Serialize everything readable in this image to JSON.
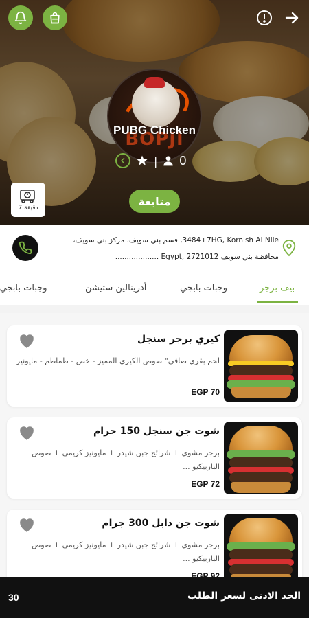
{
  "header": {
    "icons": {
      "notification": "bell-icon",
      "cart": "shopping-bag-icon",
      "info": "info-icon",
      "back": "arrow-right-icon"
    },
    "accent_color": "#7cb342"
  },
  "store": {
    "name": "PUBG Chicken",
    "logo_text": "BOPJI",
    "follower_count": "0",
    "follow_label": "متابعة",
    "delivery_time": "7 دقيقة"
  },
  "address": {
    "line1": "3484+7HG, Kornish Al Nile, قسم بني سويف، مركز بنى سويف،",
    "line2": "محافظة بني سويف 2721012 ,Egypt ..................."
  },
  "tabs": [
    {
      "label": "بيف برجر",
      "active": true
    },
    {
      "label": "وجبات بابجي",
      "active": false
    },
    {
      "label": "أدرينالين ستيشن",
      "active": false
    },
    {
      "label": "وجبات بابجي ل",
      "active": false
    }
  ],
  "products": [
    {
      "title": "كيري برجر سنجل",
      "description": "لحم بقري صافي\" صوص الكيري المميز - خص - طماطم - مايونيز",
      "price": "EGP 70"
    },
    {
      "title": "شوت جن سنجل 150 جرام",
      "description": "برجر مشوي + شرائح جبن شيدر + مايونيز كريمي + صوص الباربيكيو ...",
      "price": "EGP 72"
    },
    {
      "title": "شوت جن دابل 300 جرام",
      "description": "برجر مشوي + شرائح جبن شيدر + مايونيز كريمي + صوص الباربيكيو ...",
      "price": "EGP 92"
    }
  ],
  "footer": {
    "label": "الحد الادنى لسعر الطلب",
    "value": "30"
  }
}
